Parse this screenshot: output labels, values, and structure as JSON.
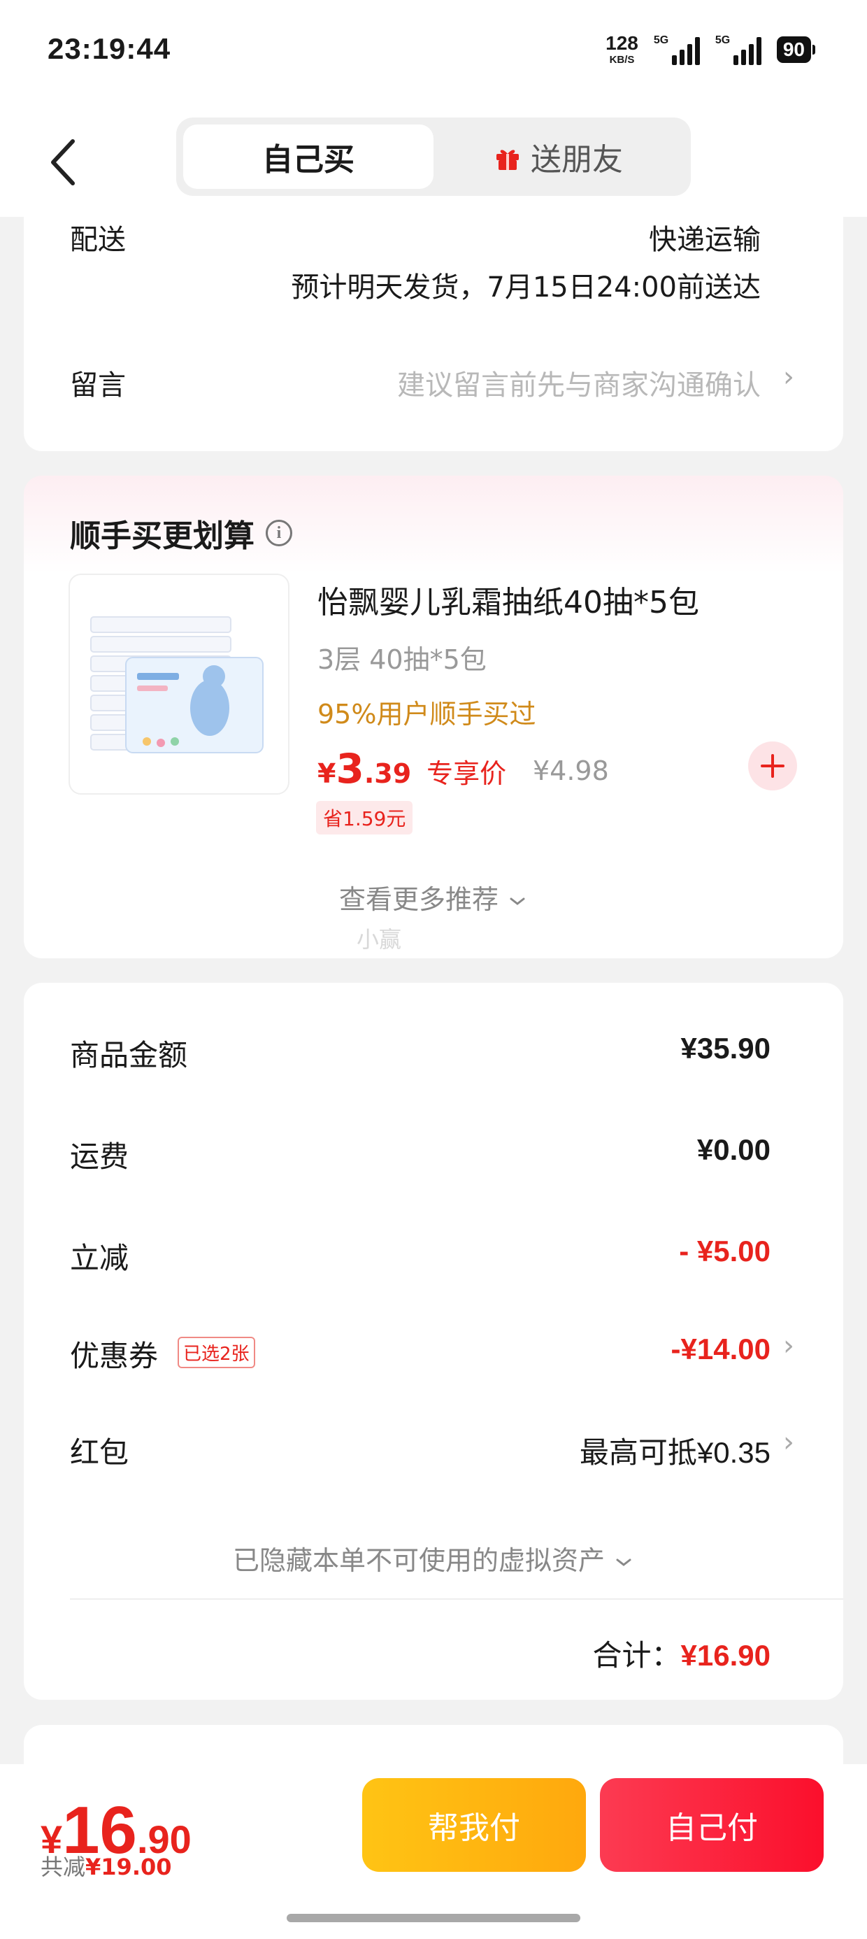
{
  "status_bar": {
    "time": "23:19:44",
    "net_speed": "128",
    "net_unit": "KB/S",
    "sig1_tag": "5G",
    "sig2_tag": "5G",
    "battery": "90"
  },
  "header": {
    "tab_self": "自己买",
    "tab_gift": "送朋友"
  },
  "delivery": {
    "label": "配送",
    "method": "快递运输",
    "estimate": "预计明天发货，7月15日24:00前送达"
  },
  "message": {
    "label": "留言",
    "placeholder": "建议留言前先与商家沟通确认"
  },
  "addon": {
    "title": "顺手买更划算",
    "info_icon": "i",
    "product": {
      "title": "怡飘婴儿乳霜抽纸40抽*5包",
      "spec": "3层 40抽*5包",
      "buy_rate": "95%用户顺手买过",
      "price_symbol": "¥",
      "price_int": "3",
      "price_dec": ".39",
      "price_tag": "专享价",
      "orig_price": "¥4.98",
      "save": "省1.59元"
    },
    "more": "查看更多推荐"
  },
  "watermark": "小赢",
  "summary": {
    "goods_label": "商品金额",
    "goods_value": "¥35.90",
    "shipping_label": "运费",
    "shipping_value": "¥0.00",
    "discount_label": "立减",
    "discount_value": "- ¥5.00",
    "coupon_label": "优惠券",
    "coupon_badge": "已选2张",
    "coupon_value": "-¥14.00",
    "redpacket_label": "红包",
    "redpacket_value": "最高可抵¥0.35",
    "hidden_assets": "已隐藏本单不可使用的虚拟资产",
    "total_label": "合计：",
    "total_value": "¥16.90"
  },
  "bottom": {
    "price_symbol": "¥",
    "price_int": "16",
    "price_dec": ".90",
    "saved_label": "共减",
    "saved_value": "¥19.00",
    "help_pay": "帮我付",
    "self_pay": "自己付"
  },
  "colors": {
    "accent_red": "#e8231d",
    "help_btn": "#ffb80f",
    "self_btn": "#fb2740"
  },
  "icons": [
    "back-chevron-icon",
    "gift-icon",
    "info-icon",
    "chevron-right-icon",
    "plus-icon",
    "chevron-down-icon"
  ]
}
